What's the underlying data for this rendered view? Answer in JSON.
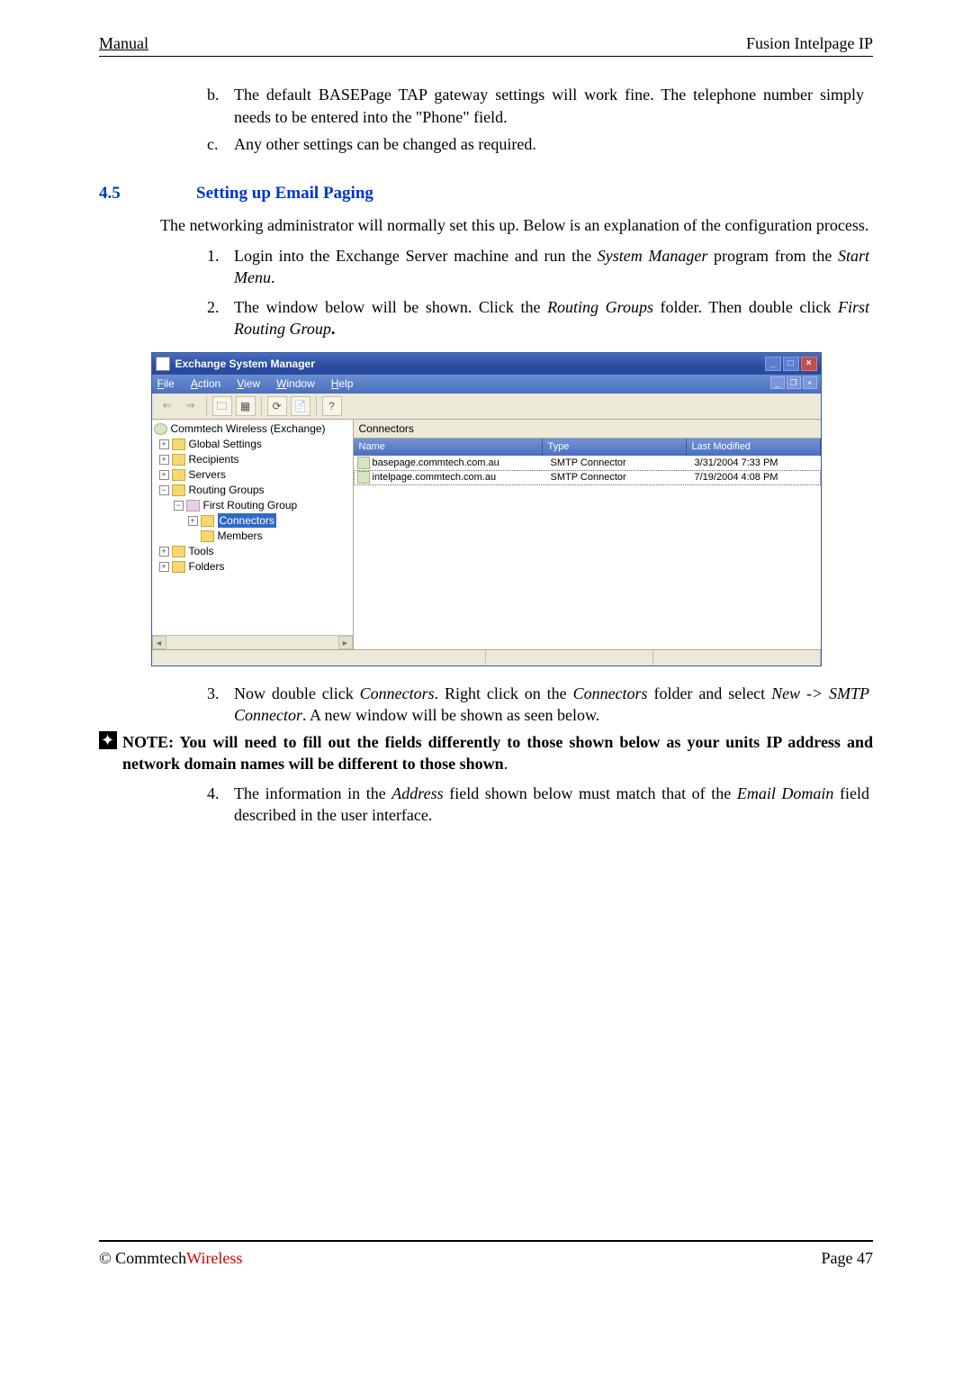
{
  "header": {
    "left": "Manual",
    "right": "Fusion Intelpage IP"
  },
  "list_b": {
    "marker": "b.",
    "text": "The default BASEPage TAP gateway settings will work fine. The telephone number simply needs to be entered into the \"Phone\" field."
  },
  "list_c": {
    "marker": "c.",
    "text": "Any other settings can be changed as required."
  },
  "section": {
    "num": "4.5",
    "title": "Setting up Email Paging"
  },
  "intro": "The networking administrator will normally set this up. Below is an explanation of the configuration process.",
  "step1": {
    "marker": "1.",
    "pre": "Login into the Exchange Server machine and run the ",
    "em1": "System Manager",
    "mid": " program from the ",
    "em2": "Start Menu",
    "post": "."
  },
  "step2": {
    "marker": "2.",
    "pre": "The window below will be shown. Click the ",
    "em1": "Routing Groups",
    "mid": " folder. Then double click ",
    "em2": "First Routing Group",
    "post": "."
  },
  "screenshot": {
    "title": "Exchange System Manager",
    "menus": {
      "file": "File",
      "action": "Action",
      "view": "View",
      "window": "Window",
      "help": "Help"
    },
    "tree": {
      "root": "Commtech Wireless (Exchange)",
      "n1": "Global Settings",
      "n2": "Recipients",
      "n3": "Servers",
      "n4": "Routing Groups",
      "n4a": "First Routing Group",
      "n4a1": "Connectors",
      "n4a2": "Members",
      "n5": "Tools",
      "n6": "Folders"
    },
    "pane_header": "Connectors",
    "cols": {
      "name": "Name",
      "type": "Type",
      "mod": "Last Modified"
    },
    "rows": [
      {
        "name": "basepage.commtech.com.au",
        "type": "SMTP Connector",
        "mod": "3/31/2004 7:33 PM"
      },
      {
        "name": "intelpage.commtech.com.au",
        "type": "SMTP Connector",
        "mod": "7/19/2004 4:08 PM"
      }
    ]
  },
  "step3": {
    "marker": "3.",
    "pre": "Now double click ",
    "em1": "Connectors",
    "mid1": ". Right click on the ",
    "em2": "Connectors",
    "mid2": " folder and select ",
    "em3": "New -> SMTP Connector",
    "post": ". A new window will be shown as seen below."
  },
  "note": {
    "label": "NOTE: You will need to fill out the fields differently to those shown below as your units IP address and network domain names will be different to those shown",
    "tail": "."
  },
  "step4": {
    "marker": "4.",
    "pre": "The information in the ",
    "em1": "Address",
    "mid": " field shown below must match that of the ",
    "em2": "Email Domain",
    "post": " field described in the user interface."
  },
  "footer": {
    "copyright_pre": "© Commtech",
    "copyright_red": "Wireless",
    "page": "Page 47"
  }
}
